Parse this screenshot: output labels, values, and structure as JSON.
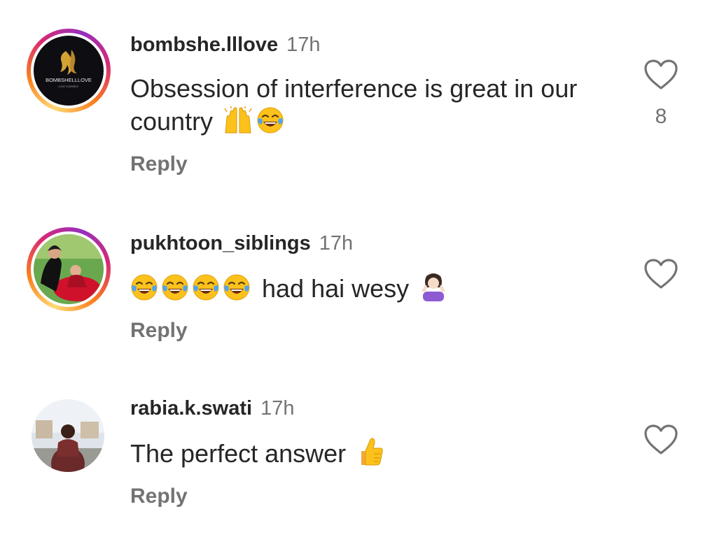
{
  "comments": [
    {
      "username": "bombshe.lllove",
      "time": "17h",
      "text": "Obsession of interference is great in our country",
      "emojis": [
        "raising-hands-emoji",
        "tears-of-joy-emoji"
      ],
      "reply_label": "Reply",
      "likes": "8",
      "avatar_logo_text": "BOMBSHELLLOVE",
      "avatar_tagline": "LOVE YOURSELF"
    },
    {
      "username": "pukhtoon_siblings",
      "time": "17h",
      "text": "had hai wesy",
      "emojis": [
        "tears-of-joy-emoji",
        "tears-of-joy-emoji",
        "tears-of-joy-emoji",
        "tears-of-joy-emoji",
        "person-shrugging-emoji"
      ],
      "reply_label": "Reply",
      "likes": ""
    },
    {
      "username": "rabia.k.swati",
      "time": "17h",
      "text": "The perfect answer",
      "emojis": [
        "thumbs-up-emoji"
      ],
      "reply_label": "Reply",
      "likes": ""
    }
  ],
  "colors": {
    "text": "#262626",
    "secondary": "#737373",
    "story_ring": [
      "#feda75",
      "#fa7e1e",
      "#d62976",
      "#962fbf"
    ]
  },
  "icons": {
    "like": "heart-outline-icon"
  }
}
